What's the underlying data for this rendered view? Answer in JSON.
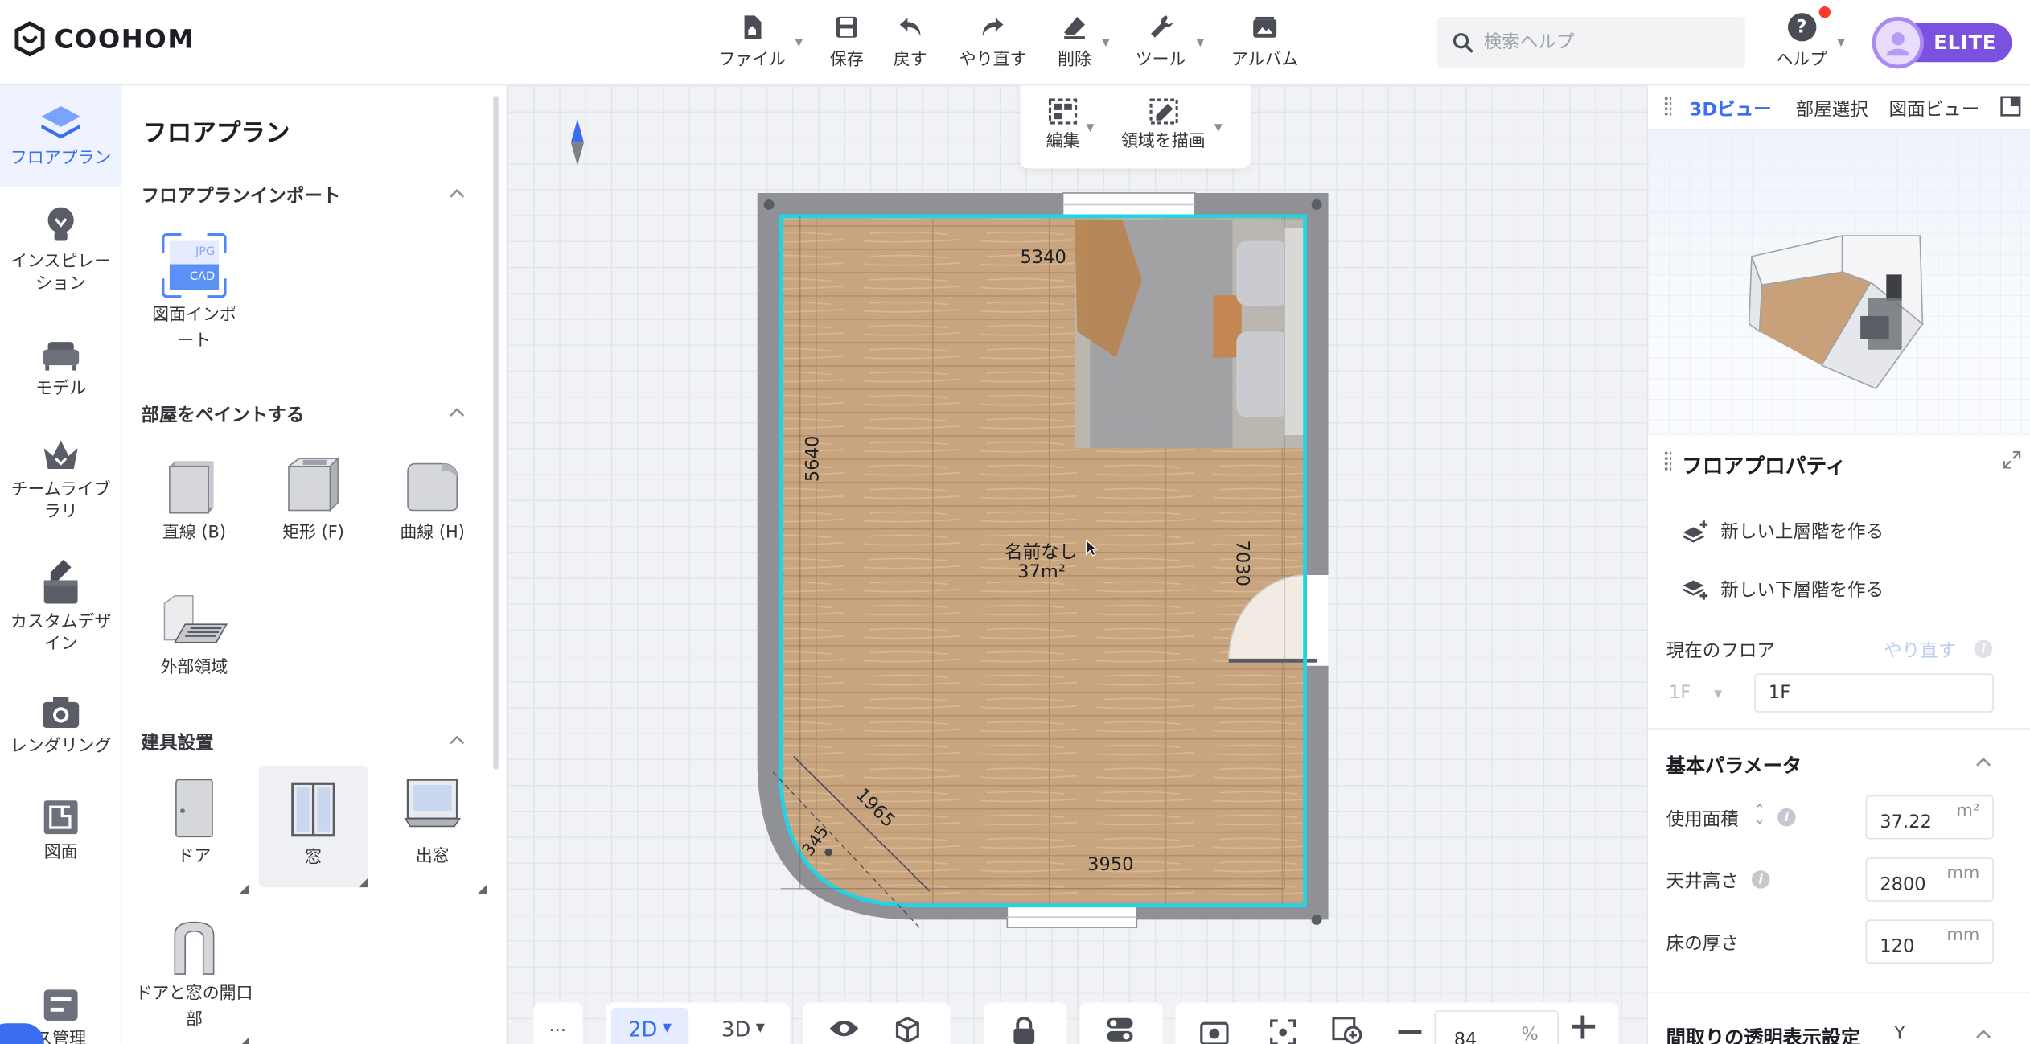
{
  "app": {
    "logo_text": "COOHOM"
  },
  "toolbar": {
    "file": "ファイル",
    "save": "保存",
    "undo": "戻す",
    "redo": "やり直す",
    "delete": "削除",
    "tools": "ツール",
    "album": "アルバム"
  },
  "search": {
    "placeholder": "検索ヘルプ"
  },
  "help": {
    "label": "ヘルプ"
  },
  "account": {
    "badge": "ELITE"
  },
  "leftnav": {
    "floorplan": "フロアプラン",
    "inspiration": "インスピレーション",
    "model": "モデル",
    "team_library": "チームライブラリ",
    "custom_design": "カスタムデザイン",
    "rendering": "レンダリング",
    "drawing": "図面",
    "manage": "ス管理"
  },
  "panel": {
    "title": "フロアプラン",
    "import_section": "フロアプランインポート",
    "import_item": "図面インポート",
    "import_icon_jpg": "JPG",
    "import_icon_cad": "CAD",
    "paint_section": "部屋をペイントする",
    "paint_items": [
      "直線 (B)",
      "矩形 (F)",
      "曲線 (H)",
      "外部領域"
    ],
    "fixtures_section": "建具設置",
    "fixture_items": [
      "ドア",
      "窓",
      "出窓",
      "ドアと窓の開口部"
    ]
  },
  "canvas_tools": {
    "edit": "編集",
    "draw_area": "領域を描画"
  },
  "plan": {
    "room_name": "名前なし",
    "room_area": "37m²",
    "dims": {
      "top": "5340",
      "left": "5640",
      "right": "7030",
      "bottom": "3950",
      "diag": "1965",
      "small": "345"
    }
  },
  "bottom": {
    "more": "...",
    "mode_2d": "2D",
    "mode_3d": "3D",
    "zoom_value": "84",
    "zoom_unit": "%"
  },
  "right": {
    "tabs": [
      "3Dビュー",
      "部屋選択",
      "図面ビュー"
    ],
    "props_title": "フロアプロパティ",
    "add_upper": "新しい上層階を作る",
    "add_lower": "新しい下層階を作る",
    "current_floor_label": "現在のフロア",
    "redo_link": "やり直す",
    "floor_select": "1F",
    "floor_name": "1F",
    "basic_params": "基本パラメータ",
    "area_label": "使用面積",
    "area_value": "37.22",
    "area_unit": "m²",
    "ceiling_label": "天井高さ",
    "ceiling_value": "2800",
    "ceiling_unit": "mm",
    "floor_thick_label": "床の厚さ",
    "floor_thick_value": "120",
    "floor_thick_unit": "mm",
    "transparency_label": "間取りの透明表示設定",
    "transparency_key": "Y"
  },
  "colors": {
    "accent": "#3a6df0",
    "elite": "#7b52e0",
    "selection": "#22d3e6"
  }
}
